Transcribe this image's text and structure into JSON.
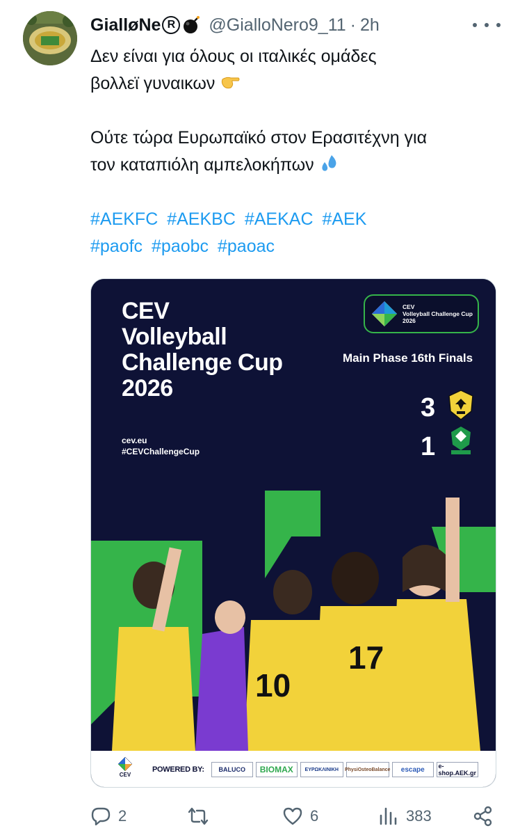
{
  "tweet": {
    "display_name": "GialløNe",
    "registered_symbol": "R",
    "handle": "@GialloNero9_11",
    "separator": "·",
    "time": "2h",
    "text_line1": "Δεν είναι για όλους οι ιταλικές ομάδες",
    "text_line2": "βολλεϊ γυναικων",
    "text_line3": "Ούτε τώρα Ευρωπαϊκό στον Ερασιτέχνη για",
    "text_line4": "τον καταπιόλη αμπελοκήπων",
    "hashtags_row1": [
      "#AEKFC",
      "#AEKBC",
      "#AEKAC",
      "#AEK"
    ],
    "hashtags_row2": [
      "#paofc",
      "#paobc",
      "#paoac"
    ]
  },
  "media": {
    "title_lines": [
      "CEV",
      "Volleyball",
      "Challenge Cup",
      "2026"
    ],
    "site": "cev.eu",
    "hashtag": "#CEVChallengeCup",
    "badge_lines": [
      "CEV",
      "Volleyball Challenge Cup",
      "2026"
    ],
    "phase": "Main Phase 16th Finals",
    "home_score": "3",
    "away_score": "1",
    "cev_small": "CEV",
    "powered_by": "POWERED BY:",
    "sponsors": {
      "baluco": "BALUCO",
      "biomax": "BIOMAX",
      "euro": "ΕΥΡΩΚΛΙΝΙΚΗ",
      "physio": "PhysiOsteoBalance",
      "escape": "escape",
      "eshop": "e-shop.AEK.gr"
    },
    "colors": {
      "navy": "#0e1236",
      "green": "#35b44a",
      "yellow": "#f2d23a"
    }
  },
  "actions": {
    "replies": "2",
    "reposts": "",
    "likes": "6",
    "views": "383"
  },
  "icons": {
    "avatar": "stadium-avatar",
    "more": "more-dots-icon",
    "reply": "reply-icon",
    "repost": "repost-icon",
    "like": "heart-icon",
    "views": "views-icon",
    "share": "share-icon"
  }
}
